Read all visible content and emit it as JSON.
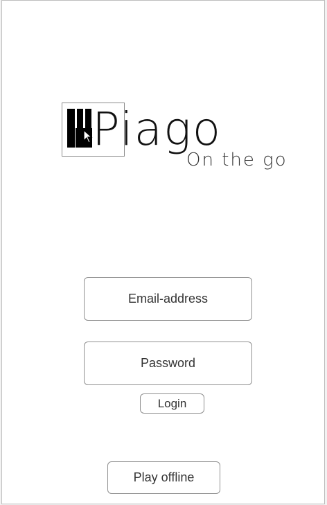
{
  "brand": {
    "name": "Piago",
    "tagline": "On the go",
    "logo_icon": "piano-keys-icon"
  },
  "form": {
    "email_label": "Email-address",
    "password_label": "Password",
    "login_label": "Login",
    "offline_label": "Play offline"
  },
  "colors": {
    "text": "#333333",
    "border": "#8f8f8f",
    "background": "#ffffff"
  }
}
